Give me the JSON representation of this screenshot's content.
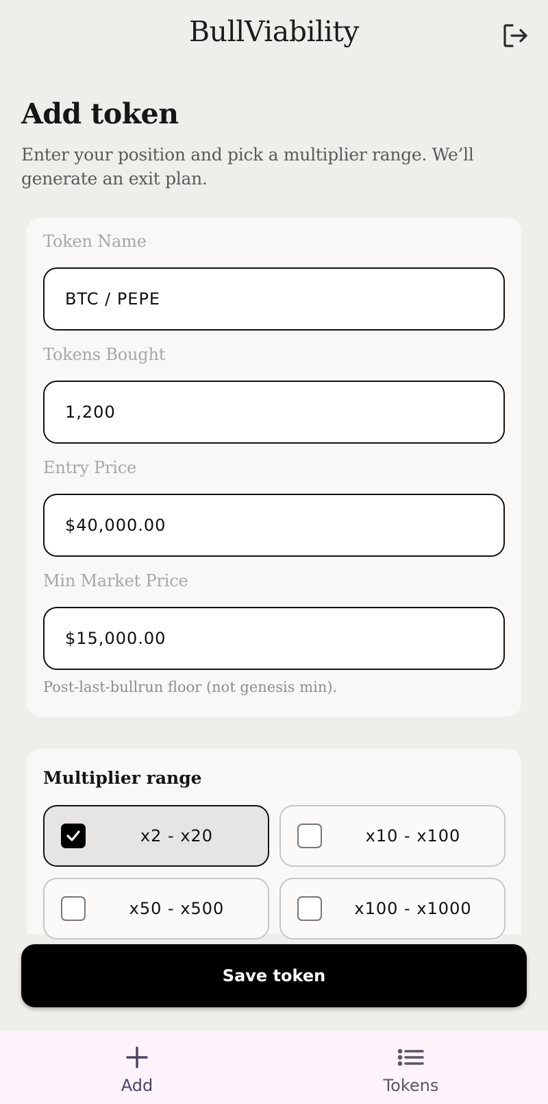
{
  "header": {
    "app_title": "BullViability",
    "logout_icon": "logout-icon"
  },
  "page": {
    "title": "Add token",
    "subtitle": "Enter your position and pick a multiplier range. We’ll generate an exit plan."
  },
  "form": {
    "token_name": {
      "label": "Token Name",
      "value": "BTC / PEPE"
    },
    "tokens_bought": {
      "label": "Tokens Bought",
      "value": "1,200"
    },
    "entry_price": {
      "label": "Entry Price",
      "value": "$40,000.00"
    },
    "min_market_price": {
      "label": "Min Market Price",
      "value": "$15,000.00",
      "helper": "Post-last-bullrun floor (not genesis min)."
    }
  },
  "multiplier": {
    "title": "Multiplier range",
    "options": [
      {
        "label": "x2 - x20",
        "checked": true
      },
      {
        "label": "x10 - x100",
        "checked": false
      },
      {
        "label": "x50 - x500",
        "checked": false
      },
      {
        "label": "x100 - x1000",
        "checked": false
      }
    ]
  },
  "actions": {
    "save_label": "Save token"
  },
  "nav": {
    "items": [
      {
        "label": "Add",
        "icon": "plus-icon",
        "active": true
      },
      {
        "label": "Tokens",
        "icon": "list-icon",
        "active": false
      }
    ]
  },
  "colors": {
    "accent": "#000000",
    "background": "#efeeeb",
    "nav_background": "#fcf4fa",
    "nav_active": "#4c4466"
  }
}
